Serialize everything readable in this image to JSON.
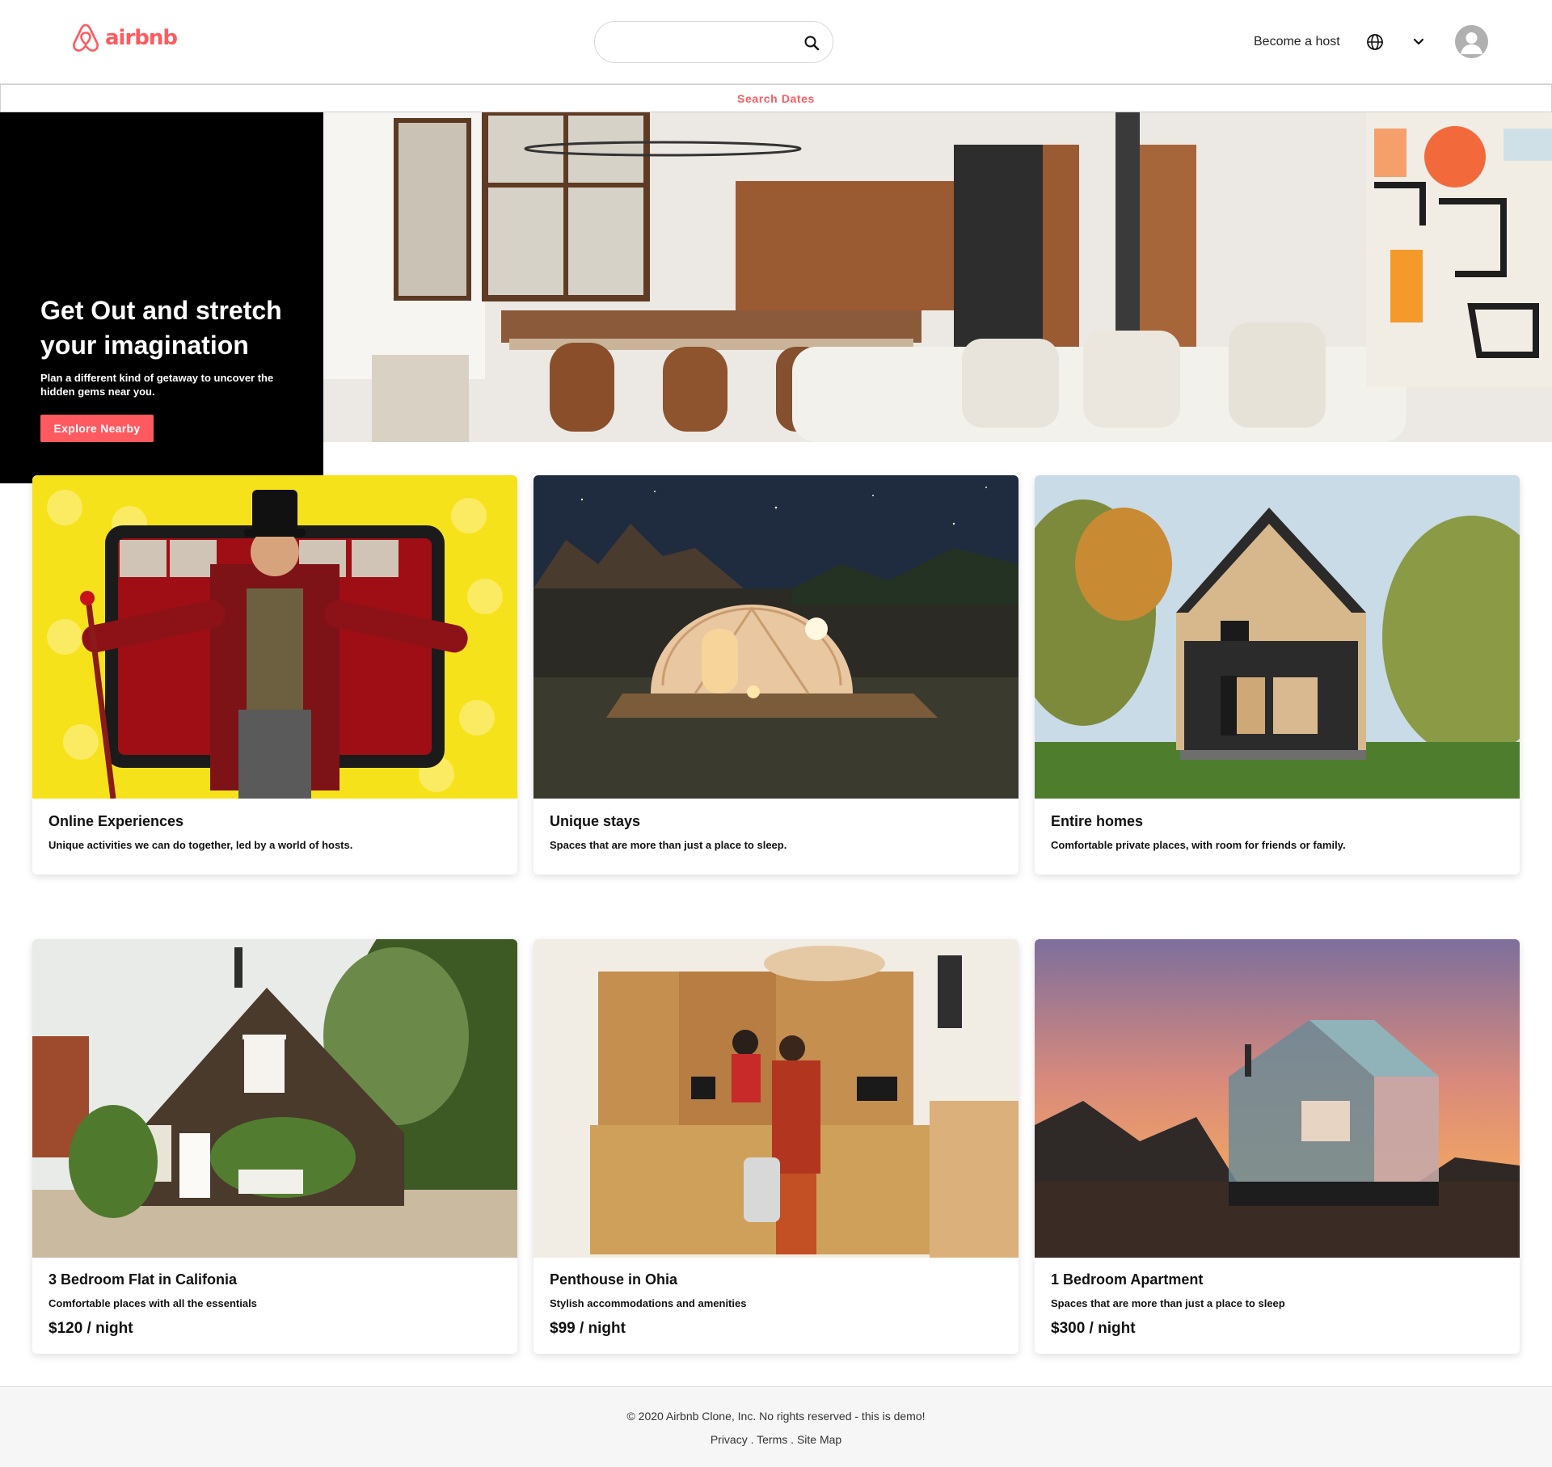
{
  "brand": {
    "name": "airbnb",
    "color": "#ff5a5f",
    "logo_icon": "airbnb-belo-icon"
  },
  "header": {
    "search": {
      "value": "",
      "placeholder": "",
      "icon": "search-icon"
    },
    "host_link": "Become a host",
    "globe_icon": "globe-icon",
    "menu_icon": "chevron-down-icon",
    "avatar_icon": "user-avatar-icon"
  },
  "dates_bar": {
    "label": "Search Dates"
  },
  "hero": {
    "title": "Get Out and stretch your imagination",
    "subtitle": "Plan a different kind of getaway to uncover the hidden gems near you.",
    "button": "Explore Nearby"
  },
  "categories": [
    {
      "title": "Online Experiences",
      "description": "Unique activities we can do together, led by a world of hosts."
    },
    {
      "title": "Unique stays",
      "description": "Spaces that are more than just a place to sleep."
    },
    {
      "title": "Entire homes",
      "description": "Comfortable private places, with room for friends or family."
    }
  ],
  "listings": [
    {
      "title": "3 Bedroom Flat in Califonia",
      "description": "Comfortable places with all the essentials",
      "price": "$120 / night"
    },
    {
      "title": "Penthouse in Ohia",
      "description": "Stylish accommodations and amenities",
      "price": "$99 / night"
    },
    {
      "title": "1 Bedroom Apartment",
      "description": "Spaces that are more than just a place to sleep",
      "price": "$300 / night"
    }
  ],
  "footer": {
    "copyright": "© 2020 Airbnb Clone, Inc. No rights reserved - this is demo!",
    "links": [
      "Privacy",
      "Terms",
      "Site Map"
    ]
  }
}
